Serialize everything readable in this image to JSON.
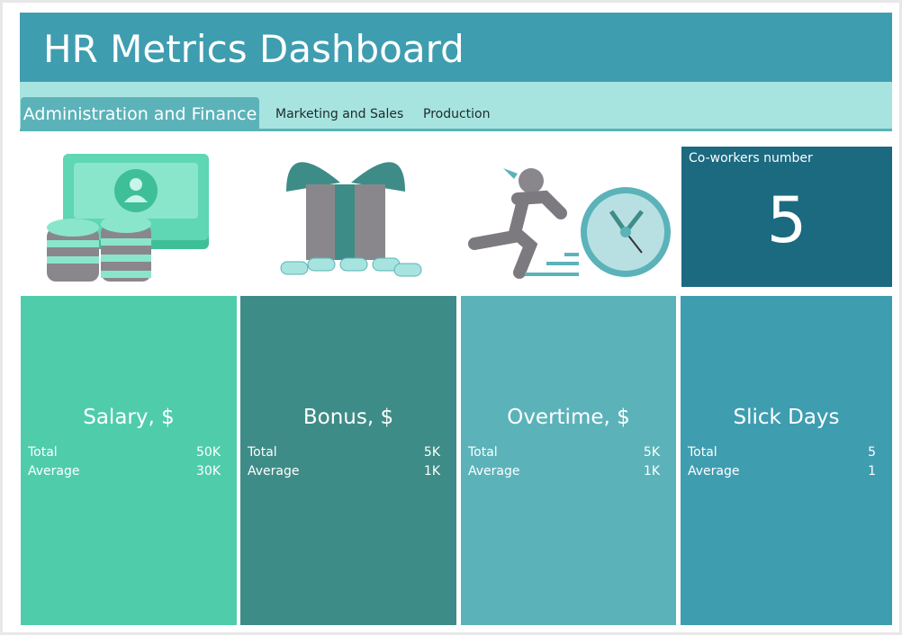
{
  "header": {
    "title": "HR Metrics Dashboard"
  },
  "tabs": [
    {
      "label": "Administration and Finance",
      "active": true
    },
    {
      "label": "Marketing and Sales"
    },
    {
      "label": "Production"
    }
  ],
  "coworkers": {
    "label": "Co-workers number",
    "value": "5"
  },
  "cards": [
    {
      "title": "Salary, $",
      "total_label": "Total",
      "total": "50K",
      "average_label": "Average",
      "average": "30K",
      "color": "#4fcdab"
    },
    {
      "title": "Bonus, $",
      "total_label": "Total",
      "total": "5K",
      "average_label": "Average",
      "average": "1K",
      "color": "#3e8c87"
    },
    {
      "title": "Overtime, $",
      "total_label": "Total",
      "total": "5K",
      "average_label": "Average",
      "average": "1K",
      "color": "#5bb3b9"
    },
    {
      "title": "Slick Days",
      "total_label": "Total",
      "total": "5",
      "average_label": "Average",
      "average": "1",
      "color": "#3f9db0"
    }
  ]
}
